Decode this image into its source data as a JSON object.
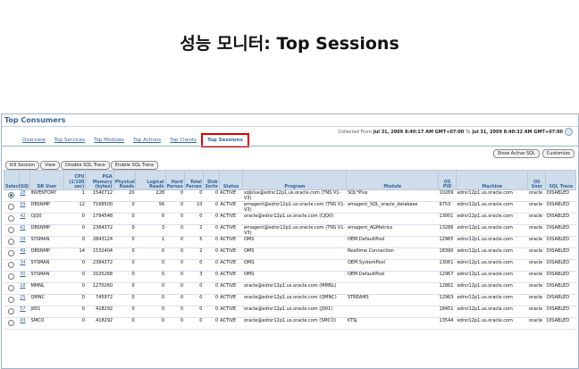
{
  "slide_title": "성능 모니터: Top Sessions",
  "panel": {
    "title": "Top Consumers",
    "collected_prefix": "Collected From",
    "from": "Jul 31, 2009 8:40:17 AM GMT+07:00",
    "to_word": "To",
    "to": "Jul 31, 2009 8:40:32 AM GMT+07:00"
  },
  "tabs": [
    "Overview",
    "Top Services",
    "Top Modules",
    "Top Actions",
    "Top Clients",
    "Top Sessions"
  ],
  "active_tab": "Top Sessions",
  "right_buttons": [
    "Show Active SQL",
    "Customize"
  ],
  "left_buttons": [
    "Kill Session",
    "View",
    "Disable SQL Trace",
    "Enable SQL Trace"
  ],
  "columns": [
    "Select",
    "SID",
    "DB User",
    "CPU (1/100 sec)",
    "PGA Memory (bytes)",
    "Physical Reads",
    "Logical Reads",
    "Hard Parses",
    "Total Parses",
    "Disk Sorts",
    "Status",
    "Program",
    "Module",
    "OS PID",
    "Machine",
    "OS User",
    "SQL Trace"
  ],
  "rows": [
    {
      "sid": "28",
      "user": "INVENTORY",
      "cpu": "1",
      "pga": "1540712",
      "phys": "20",
      "logical": "228",
      "hard": "0",
      "total": "0",
      "disk": "0",
      "status": "ACTIVE",
      "program": "sqlplus@edrsr12p1.us.oracle.com (TNS V1-V3)",
      "module": "SQL*Plus",
      "pid": "10269",
      "machine": "edrsr12p1.us.oracle.com",
      "osuser": "oracle",
      "trace": "DISABLED",
      "selected": true
    },
    {
      "sid": "59",
      "user": "DBSNMP",
      "cpu": "12",
      "pga": "7168500",
      "phys": "0",
      "logical": "56",
      "hard": "0",
      "total": "10",
      "disk": "0",
      "status": "ACTIVE",
      "program": "emagent@edrsr12p1.us.oracle.com (TNS V1-V3)",
      "module": "emagent_SQL_oracle_database",
      "pid": "9753",
      "machine": "edrsr12p1.us.oracle.com",
      "osuser": "oracle",
      "trace": "DISABLED",
      "selected": false
    },
    {
      "sid": "42",
      "user": "CJQ0",
      "cpu": "0",
      "pga": "1794548",
      "phys": "0",
      "logical": "6",
      "hard": "0",
      "total": "0",
      "disk": "0",
      "status": "ACTIVE",
      "program": "oracle@edrsr12p1.us.oracle.com (CJQ0)",
      "module": "",
      "pid": "13001",
      "machine": "edrsr12p1.us.oracle.com",
      "osuser": "oracle",
      "trace": "DISABLED",
      "selected": false
    },
    {
      "sid": "41",
      "user": "DBSNMP",
      "cpu": "0",
      "pga": "2384372",
      "phys": "0",
      "logical": "3",
      "hard": "0",
      "total": "2",
      "disk": "0",
      "status": "ACTIVE",
      "program": "emagent@edrsr12p1.us.oracle.com (TNS V1-V3)",
      "module": "emagent_AGMetrics",
      "pid": "13286",
      "machine": "edrsr12p1.us.oracle.com",
      "osuser": "oracle",
      "trace": "DISABLED",
      "selected": false
    },
    {
      "sid": "29",
      "user": "SYSMAN",
      "cpu": "0",
      "pga": "2843124",
      "phys": "0",
      "logical": "1",
      "hard": "0",
      "total": "5",
      "disk": "0",
      "status": "ACTIVE",
      "program": "OMS",
      "module": "OEM.DefaultPool",
      "pid": "12965",
      "machine": "edrsr12p1.us.oracle.com",
      "osuser": "oracle",
      "trace": "DISABLED",
      "selected": false
    },
    {
      "sid": "49",
      "user": "DBSNMP",
      "cpu": "14",
      "pga": "1532404",
      "phys": "0",
      "logical": "0",
      "hard": "0",
      "total": "2",
      "disk": "0",
      "status": "ACTIVE",
      "program": "OMS",
      "module": "Realtime Connection",
      "pid": "18390",
      "machine": "edrsr12p1.us.oracle.com",
      "osuser": "oracle",
      "trace": "DISABLED",
      "selected": false
    },
    {
      "sid": "34",
      "user": "SYSMAN",
      "cpu": "0",
      "pga": "2384372",
      "phys": "0",
      "logical": "0",
      "hard": "0",
      "total": "0",
      "disk": "0",
      "status": "ACTIVE",
      "program": "OMS",
      "module": "OEM.SystemPool",
      "pid": "13061",
      "machine": "edrsr12p1.us.oracle.com",
      "osuser": "oracle",
      "trace": "DISABLED",
      "selected": false
    },
    {
      "sid": "30",
      "user": "SYSMAN",
      "cpu": "0",
      "pga": "3105268",
      "phys": "0",
      "logical": "0",
      "hard": "0",
      "total": "3",
      "disk": "0",
      "status": "ACTIVE",
      "program": "OMS",
      "module": "OEM.DefaultPool",
      "pid": "12967",
      "machine": "edrsr12p1.us.oracle.com",
      "osuser": "oracle",
      "trace": "DISABLED",
      "selected": false
    },
    {
      "sid": "18",
      "user": "MMNL",
      "cpu": "0",
      "pga": "1270260",
      "phys": "0",
      "logical": "0",
      "hard": "0",
      "total": "0",
      "disk": "0",
      "status": "ACTIVE",
      "program": "oracle@edrsr12p1.us.oracle.com (MMNL)",
      "module": "",
      "pid": "12861",
      "machine": "edrsr12p1.us.oracle.com",
      "osuser": "oracle",
      "trace": "DISABLED",
      "selected": false
    },
    {
      "sid": "25",
      "user": "QMNC",
      "cpu": "0",
      "pga": "745972",
      "phys": "0",
      "logical": "0",
      "hard": "0",
      "total": "0",
      "disk": "0",
      "status": "ACTIVE",
      "program": "oracle@edrsr12p1.us.oracle.com (QMNC)",
      "module": "STREAMS",
      "pid": "12963",
      "machine": "edrsr12p1.us.oracle.com",
      "osuser": "oracle",
      "trace": "DISABLED",
      "selected": false
    },
    {
      "sid": "57",
      "user": "J001",
      "cpu": "0",
      "pga": "418292",
      "phys": "0",
      "logical": "0",
      "hard": "0",
      "total": "0",
      "disk": "0",
      "status": "ACTIVE",
      "program": "oracle@edrsr12p1.us.oracle.com (J001)",
      "module": "",
      "pid": "18451",
      "machine": "edrsr12p1.us.oracle.com",
      "osuser": "oracle",
      "trace": "DISABLED",
      "selected": false
    },
    {
      "sid": "43",
      "user": "SMCO",
      "cpu": "0",
      "pga": "418292",
      "phys": "0",
      "logical": "0",
      "hard": "0",
      "total": "0",
      "disk": "0",
      "status": "ACTIVE",
      "program": "oracle@edrsr12p1.us.oracle.com (SMCO)",
      "module": "KTSJ",
      "pid": "13544",
      "machine": "edrsr12p1.us.oracle.com",
      "osuser": "oracle",
      "trace": "DISABLED",
      "selected": false
    }
  ],
  "colors": {
    "accent": "#336699",
    "header_bg": "#cfdceb",
    "active_tab_border": "#e00000"
  },
  "icons": {
    "refresh": "refresh-icon",
    "radio": "radio-button"
  }
}
